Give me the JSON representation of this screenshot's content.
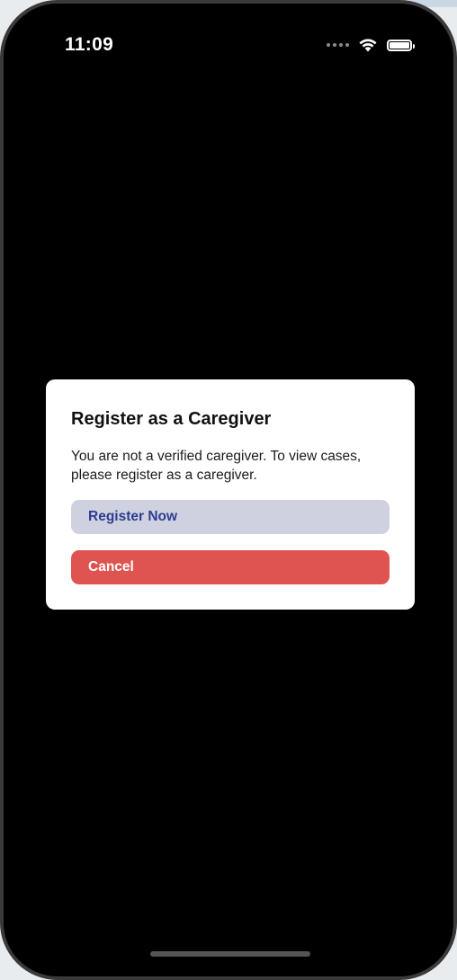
{
  "status_bar": {
    "time": "11:09",
    "icons": [
      "signal-dots-icon",
      "wifi-icon",
      "battery-icon"
    ]
  },
  "dialog": {
    "title": "Register as a Caregiver",
    "message": "You are not a verified caregiver. To view cases, please register as a caregiver.",
    "register_label": "Register Now",
    "cancel_label": "Cancel"
  },
  "colors": {
    "screen_background": "#000000",
    "dialog_background": "#ffffff",
    "register_button_background": "#d0d1e0",
    "register_button_text": "#2b3e8f",
    "cancel_button_background": "#df5450",
    "cancel_button_text": "#ffffff"
  }
}
